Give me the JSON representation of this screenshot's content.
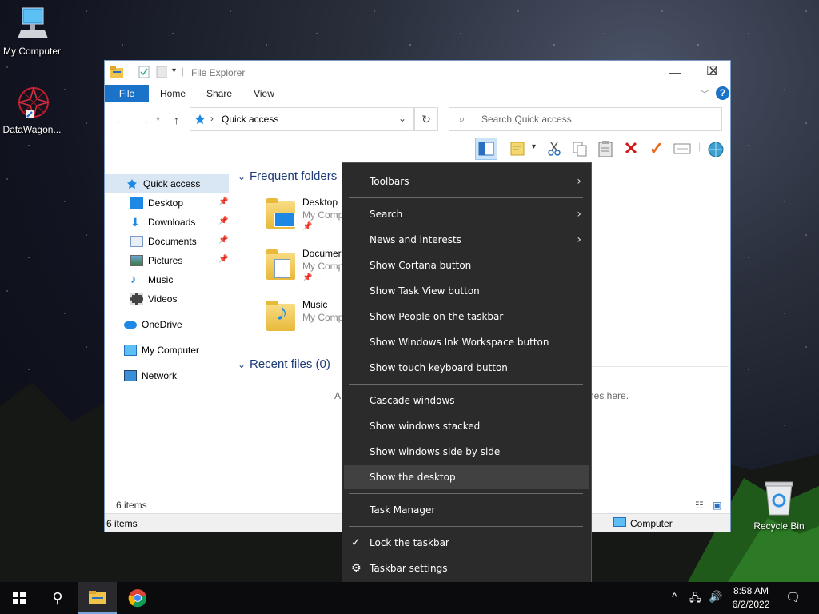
{
  "desktop": {
    "icons": [
      {
        "label": "My Computer"
      },
      {
        "label": "DataWagon..."
      },
      {
        "label": "Recycle Bin"
      }
    ]
  },
  "explorer": {
    "title": "File Explorer",
    "ribbon_tabs": [
      "File",
      "Home",
      "Share",
      "View"
    ],
    "address": "Quick access",
    "search_placeholder": "Search Quick access",
    "sidebar": [
      {
        "label": "Quick access",
        "icon": "star-icon"
      },
      {
        "label": "Desktop",
        "icon": "desktop-folder-icon",
        "pinned": true
      },
      {
        "label": "Downloads",
        "icon": "download-icon",
        "pinned": true
      },
      {
        "label": "Documents",
        "icon": "documents-icon",
        "pinned": true
      },
      {
        "label": "Pictures",
        "icon": "pictures-icon",
        "pinned": true
      },
      {
        "label": "Music",
        "icon": "music-icon"
      },
      {
        "label": "Videos",
        "icon": "videos-icon"
      },
      {
        "label": "OneDrive",
        "icon": "cloud-icon"
      },
      {
        "label": "My Computer",
        "icon": "computer-icon"
      },
      {
        "label": "Network",
        "icon": "network-icon"
      }
    ],
    "frequent_header": "Frequent folders",
    "frequent_folders": [
      {
        "name": "Desktop",
        "location": "My Comp"
      },
      {
        "name": "Documer",
        "location": "My Comp"
      },
      {
        "name": "Music",
        "location": "My Comp"
      }
    ],
    "recent_header": "Recent files (0)",
    "recent_empty_left": "A",
    "recent_empty_right": "nes here.",
    "items_count": "6 items",
    "status_items": "6 items",
    "status_computer": "Computer"
  },
  "context_menu": {
    "items": [
      {
        "label": "Toolbars",
        "submenu": true
      },
      {
        "label": "Search",
        "submenu": true
      },
      {
        "label": "News and interests",
        "submenu": true
      },
      {
        "label": "Show Cortana button"
      },
      {
        "label": "Show Task View button"
      },
      {
        "label": "Show People on the taskbar"
      },
      {
        "label": "Show Windows Ink Workspace button"
      },
      {
        "label": "Show touch keyboard button"
      },
      {
        "label": "Cascade windows"
      },
      {
        "label": "Show windows stacked"
      },
      {
        "label": "Show windows side by side"
      },
      {
        "label": "Show the desktop",
        "highlighted": true
      },
      {
        "label": "Task Manager"
      },
      {
        "label": "Lock the taskbar",
        "checked": true
      },
      {
        "label": "Taskbar settings",
        "icon": "gear-icon"
      }
    ]
  },
  "taskbar": {
    "time": "8:58 AM",
    "date": "6/2/2022"
  }
}
